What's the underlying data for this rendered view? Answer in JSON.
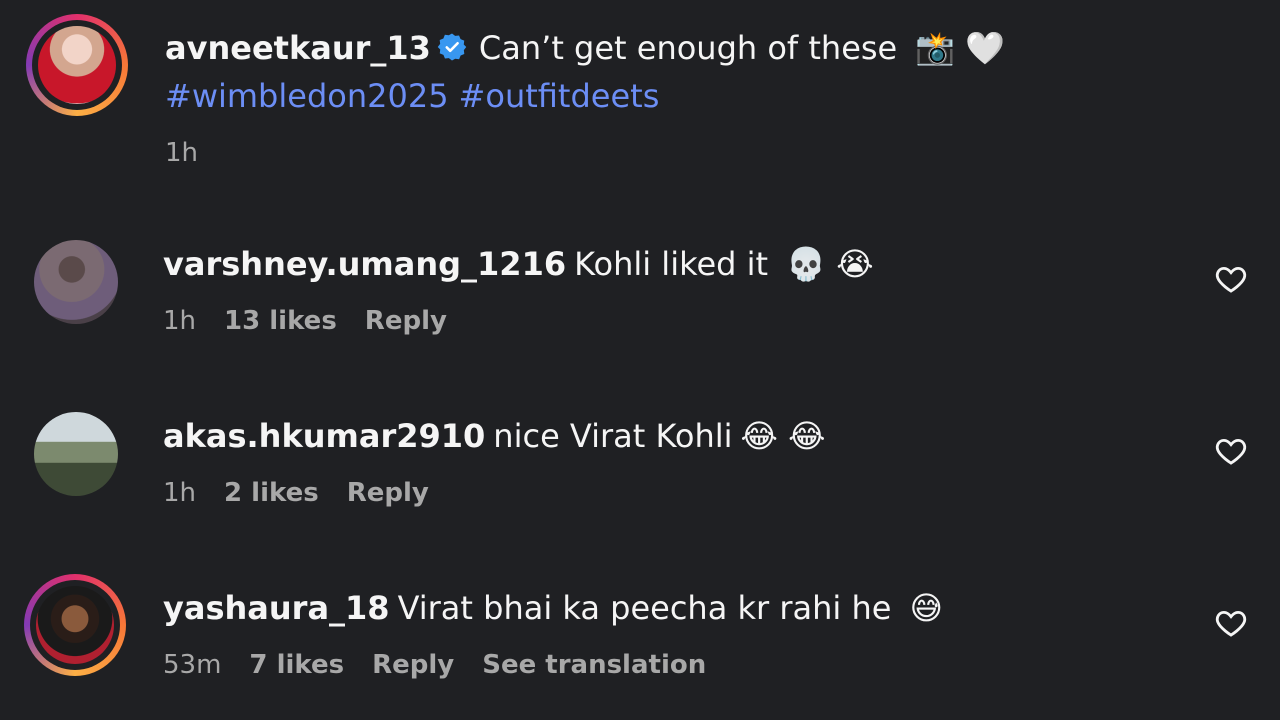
{
  "caption": {
    "username": "avneetkaur_13",
    "text": "Can’t get enough of these",
    "emojis": "📸 🤍",
    "hashtags": [
      "#wimbledon2025",
      "#outfitdeets"
    ],
    "time": "1h"
  },
  "comments": [
    {
      "username": "varshney.umang_1216",
      "text": "Kohli liked it",
      "emojis": "💀 😭",
      "time": "1h",
      "likes": "13 likes",
      "reply": "Reply"
    },
    {
      "username": "akas.hkumar2910",
      "text": "nice Virat Kohli",
      "emojis": "😂 😂",
      "time": "1h",
      "likes": "2 likes",
      "reply": "Reply"
    },
    {
      "username": "yashaura_18",
      "text": "Virat bhai ka peecha kr rahi he",
      "emojis": "😅",
      "time": "53m",
      "likes": "7 likes",
      "reply": "Reply",
      "translate": "See translation"
    }
  ],
  "icons": {
    "verified": "verified-badge-icon",
    "like": "heart-outline-icon"
  },
  "colors": {
    "background": "#1f2023",
    "hashtag": "#6c8ef5",
    "muted": "#a8a8a8",
    "verified": "#3897f0"
  }
}
